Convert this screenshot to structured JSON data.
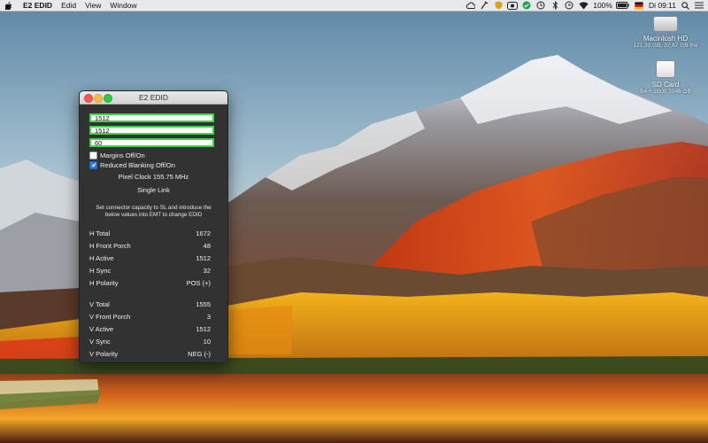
{
  "menubar": {
    "app_name": "E2 EDID",
    "menus": [
      "Edid",
      "View",
      "Window"
    ],
    "battery": "100%",
    "clock": "Di 09:11"
  },
  "desktop": {
    "drive1_name": "Macintosh HD",
    "drive1_sub": "121,33 GB, 37,67 GB frei",
    "drive2_name": "SD Card",
    "drive2_sub": "B4 ÷ 1B00 2046 GB"
  },
  "window": {
    "title": "E2 EDID",
    "field_width": "1512",
    "field_height": "1512",
    "field_refresh": "60",
    "margins_label": "Margins Off/On",
    "margins_checked": false,
    "reduced_blanking_label": "Reduced Blanking Off/On",
    "reduced_blanking_checked": true,
    "pixel_clock": "Pixel Clock 155.75 MHz",
    "link": "Single Link",
    "info_text": "Set connector capacity to SL and introduce the below values into EMT to change EDID",
    "horizontal": [
      {
        "label": "H Total",
        "value": "1672"
      },
      {
        "label": "H Front Porch",
        "value": "48"
      },
      {
        "label": "H Active",
        "value": "1512"
      },
      {
        "label": "H Sync",
        "value": "32"
      },
      {
        "label": "H Polarity",
        "value": "POS (+)"
      }
    ],
    "vertical": [
      {
        "label": "V Total",
        "value": "1555"
      },
      {
        "label": "V Front Porch",
        "value": "3"
      },
      {
        "label": "V Active",
        "value": "1512"
      },
      {
        "label": "V Sync",
        "value": "10"
      },
      {
        "label": "V Polarity",
        "value": "NEG (-)"
      }
    ]
  },
  "colors": {
    "field_border": "#3cd54a",
    "checkbox_on": "#2f7de1",
    "window_bg": "#323232"
  }
}
